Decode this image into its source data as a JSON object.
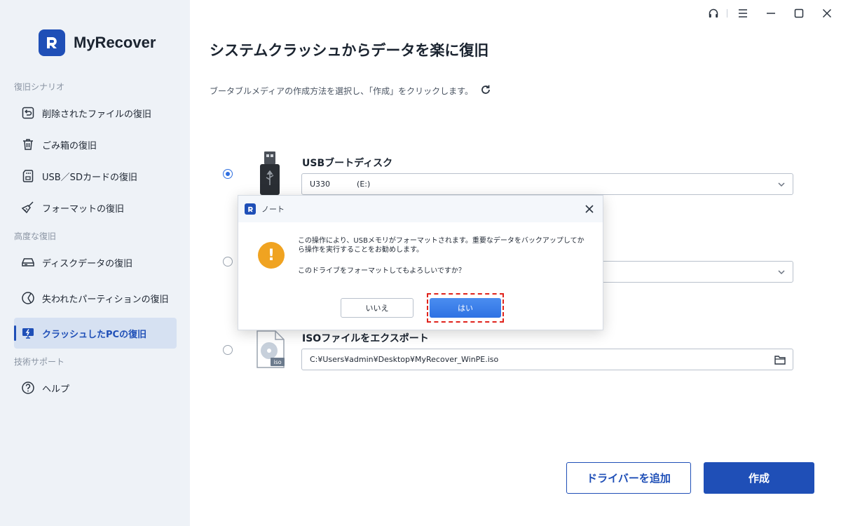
{
  "app": {
    "name": "MyRecover"
  },
  "sidebar": {
    "sections": [
      {
        "title": "復旧シナリオ"
      },
      {
        "title": "高度な復旧"
      },
      {
        "title": "技術サポート"
      }
    ],
    "items": [
      {
        "label": "削除されたファイルの復旧",
        "icon": "undo-file-icon"
      },
      {
        "label": "ごみ箱の復旧",
        "icon": "trash-icon"
      },
      {
        "label": "USB／SDカードの復旧",
        "icon": "sd-card-icon"
      },
      {
        "label": "フォーマットの復旧",
        "icon": "broom-icon"
      },
      {
        "label": "ディスクデータの復旧",
        "icon": "disk-icon"
      },
      {
        "label": "失われたパーティションの復旧",
        "icon": "partition-icon"
      },
      {
        "label": "クラッシュしたPCの復旧",
        "icon": "crashed-pc-icon",
        "active": true
      },
      {
        "label": "ヘルプ",
        "icon": "help-icon"
      }
    ]
  },
  "main": {
    "title": "システムクラッシュからデータを楽に復旧",
    "description": "ブータブルメディアの作成方法を選択し、「作成」をクリックします。",
    "options": {
      "usb": {
        "label": "USBブートディスク",
        "selected_device": "U330",
        "selected_drive": "(E:)"
      },
      "iso": {
        "label": "ISOファイルをエクスポート",
        "path": "C:¥Users¥admin¥Desktop¥MyRecover_WinPE.iso"
      }
    },
    "buttons": {
      "add_driver": "ドライバーを追加",
      "create": "作成"
    }
  },
  "dialog": {
    "title": "ノート",
    "message": "この操作により、USBメモリがフォーマットされます。重要なデータをバックアップしてから操作を実行することをお勧めします。",
    "question": "このドライブをフォーマットしてもよろしいですか？",
    "no_label": "いいえ",
    "yes_label": "はい"
  },
  "colors": {
    "accent": "#1f4fb7",
    "warning": "#f0a321",
    "highlight": "#e0231c"
  }
}
